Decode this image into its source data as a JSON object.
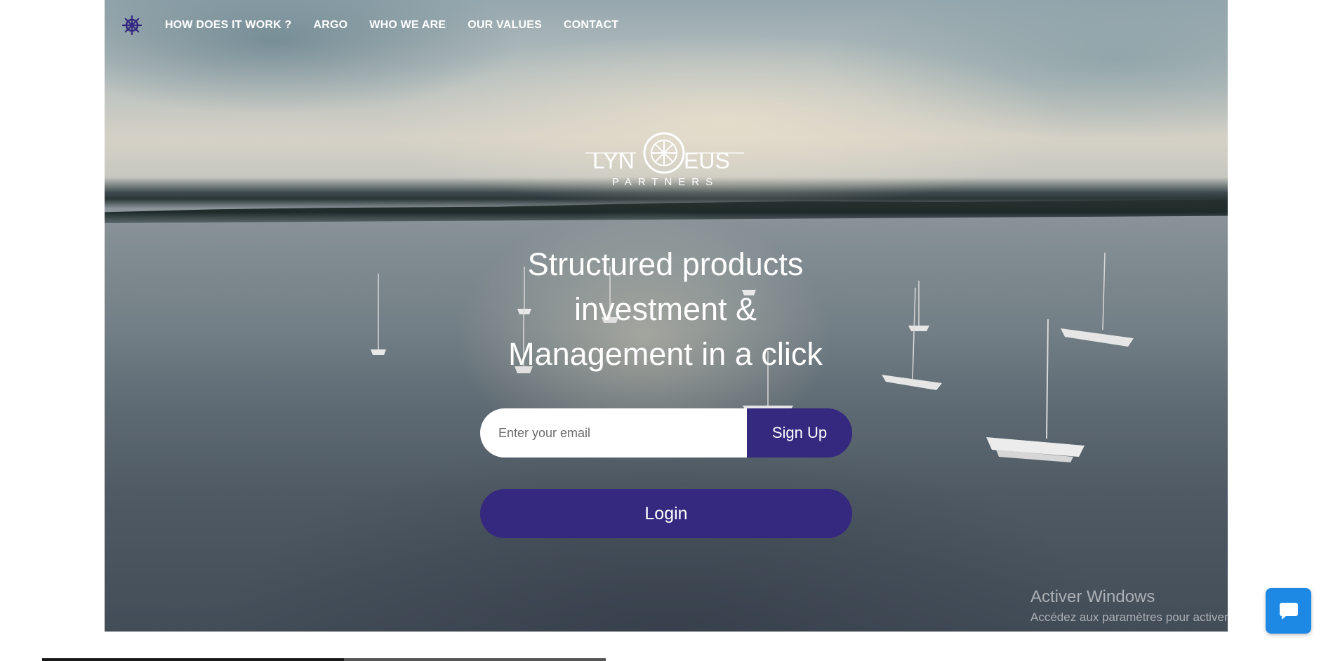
{
  "nav": {
    "logo_icon": "ship-wheel-icon",
    "items": [
      {
        "label": "HOW DOES IT WORK ?"
      },
      {
        "label": "ARGO"
      },
      {
        "label": "WHO WE ARE"
      },
      {
        "label": "OUR VALUES"
      },
      {
        "label": "CONTACT"
      }
    ]
  },
  "brand": {
    "name_left": "LYN",
    "name_right": "EUS",
    "tagline": "PARTNERS",
    "icon": "ship-wheel-icon"
  },
  "hero": {
    "headline_line1": "Structured products",
    "headline_line2": "investment &",
    "headline_line3": "Management in a click"
  },
  "signup": {
    "email_placeholder": "Enter your email",
    "email_value": "",
    "button_label": "Sign Up"
  },
  "login": {
    "button_label": "Login"
  },
  "watermark": {
    "title": "Activer Windows",
    "subtitle": "Accédez aux paramètres pour activer Windows."
  },
  "chat": {
    "icon": "chat-bubble-icon"
  },
  "colors": {
    "accent": "#35287f",
    "chat": "#1e88e5",
    "text_light": "#ffffff"
  }
}
